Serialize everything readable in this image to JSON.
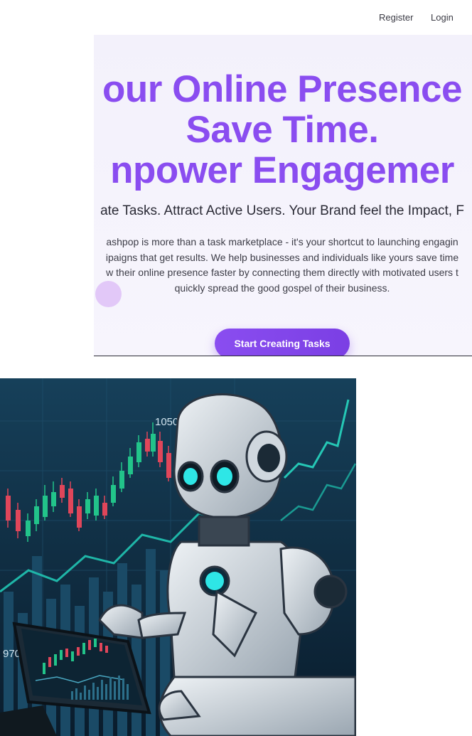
{
  "nav": {
    "register_label": "Register",
    "login_label": "Login"
  },
  "hero": {
    "title_line1": "our Online Presence",
    "title_line2": "Save Time.",
    "title_line3": "npower Engagemer",
    "subtitle": "ate Tasks. Attract Active Users. Your Brand feel the Impact, F",
    "desc_line1": "ashpop is more than a task marketplace - it's your shortcut to launching engagin",
    "desc_line2": "ipaigns that get results. We help businesses and individuals like yours save time",
    "desc_line3": "w their online presence faster by connecting them directly with motivated users t",
    "desc_line4": "quickly spread the good gospel of their business.",
    "cta_label": "Start Creating Tasks"
  },
  "illustration": {
    "price_high": "10500",
    "price_low": "970C",
    "colors": {
      "bg": "#0f2a3f",
      "candle_up": "#22c48a",
      "candle_down": "#e0465a",
      "line": "#1fb6a8",
      "robot_eye": "#2ee6e6"
    }
  }
}
